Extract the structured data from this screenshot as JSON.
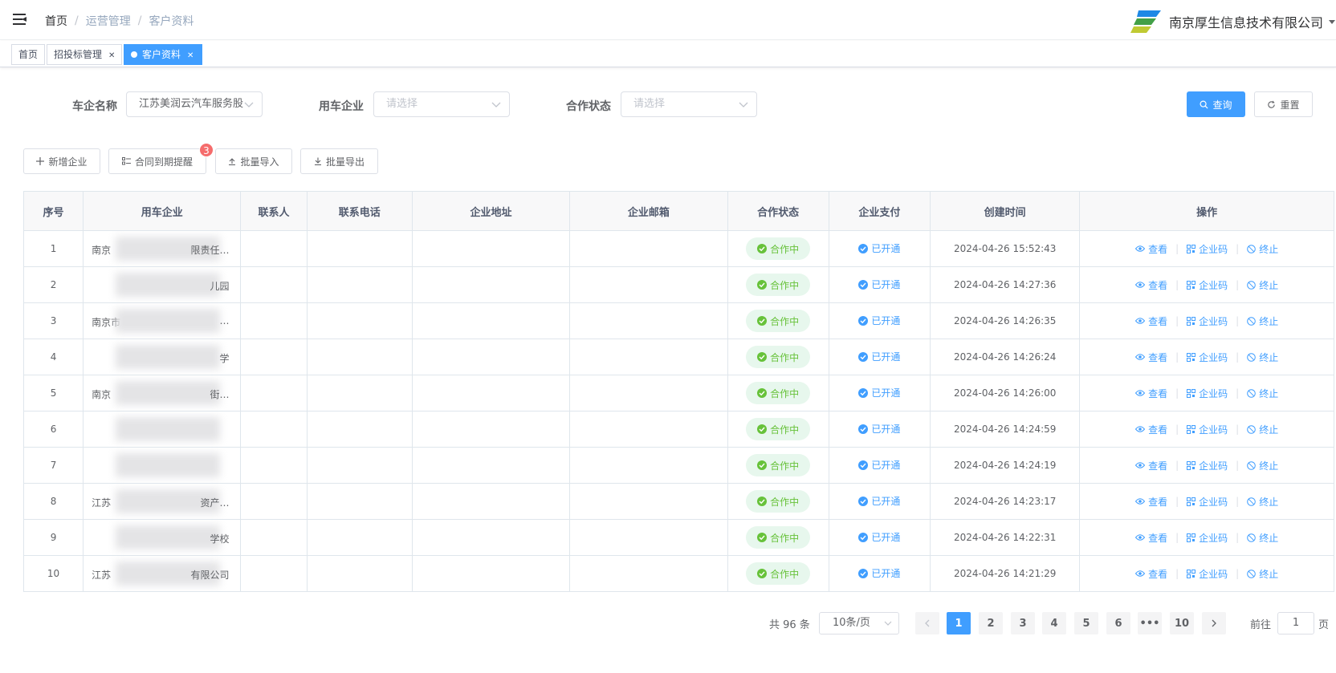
{
  "header": {
    "breadcrumb": [
      "首页",
      "运营管理",
      "客户资料"
    ],
    "company_name": "南京厚生信息技术有限公司"
  },
  "tags": [
    {
      "label": "首页",
      "closable": false,
      "active": false
    },
    {
      "label": "招投标管理",
      "closable": true,
      "active": false
    },
    {
      "label": "客户资料",
      "closable": true,
      "active": true
    }
  ],
  "filters": {
    "car_company_label": "车企名称",
    "car_company_value": "江苏美润云汽车服务股",
    "user_company_label": "用车企业",
    "user_company_placeholder": "请选择",
    "coop_status_label": "合作状态",
    "coop_status_placeholder": "请选择",
    "search_label": "查询",
    "reset_label": "重置"
  },
  "toolbar": {
    "add_label": "新增企业",
    "contract_label": "合同到期提醒",
    "contract_badge": "3",
    "import_label": "批量导入",
    "export_label": "批量导出"
  },
  "table": {
    "columns": [
      "序号",
      "用车企业",
      "联系人",
      "联系电话",
      "企业地址",
      "企业邮箱",
      "合作状态",
      "企业支付",
      "创建时间",
      "操作"
    ],
    "actions": [
      "查看",
      "企业码",
      "终止"
    ],
    "rows": [
      {
        "no": "1",
        "company": "南京",
        "company_tail": "限责任…",
        "status": "合作中",
        "pay": "已开通",
        "created": "2024-04-26 15:52:43"
      },
      {
        "no": "2",
        "company": "",
        "company_tail": "儿园",
        "status": "合作中",
        "pay": "已开通",
        "created": "2024-04-26 14:27:36"
      },
      {
        "no": "3",
        "company": "南京市",
        "company_tail": "…",
        "status": "合作中",
        "pay": "已开通",
        "created": "2024-04-26 14:26:35"
      },
      {
        "no": "4",
        "company": "",
        "company_tail": "学",
        "status": "合作中",
        "pay": "已开通",
        "created": "2024-04-26 14:26:24"
      },
      {
        "no": "5",
        "company": "南京",
        "company_tail": "街…",
        "status": "合作中",
        "pay": "已开通",
        "created": "2024-04-26 14:26:00"
      },
      {
        "no": "6",
        "company": "",
        "company_tail": "",
        "status": "合作中",
        "pay": "已开通",
        "created": "2024-04-26 14:24:59"
      },
      {
        "no": "7",
        "company": "",
        "company_tail": "",
        "status": "合作中",
        "pay": "已开通",
        "created": "2024-04-26 14:24:19"
      },
      {
        "no": "8",
        "company": "江苏",
        "company_tail": "资产…",
        "status": "合作中",
        "pay": "已开通",
        "created": "2024-04-26 14:23:17"
      },
      {
        "no": "9",
        "company": "",
        "company_tail": "学校",
        "status": "合作中",
        "pay": "已开通",
        "created": "2024-04-26 14:22:31"
      },
      {
        "no": "10",
        "company": "江苏",
        "company_tail": "有限公司",
        "status": "合作中",
        "pay": "已开通",
        "created": "2024-04-26 14:21:29"
      }
    ]
  },
  "pagination": {
    "total_text": "共 96 条",
    "page_size": "10条/页",
    "pages": [
      "1",
      "2",
      "3",
      "4",
      "5",
      "6",
      "•••",
      "10"
    ],
    "current": "1",
    "goto_prefix": "前往",
    "goto_value": "1",
    "goto_suffix": "页"
  },
  "colors": {
    "primary": "#409eff",
    "success": "#67c23a",
    "danger": "#f56c6c"
  }
}
